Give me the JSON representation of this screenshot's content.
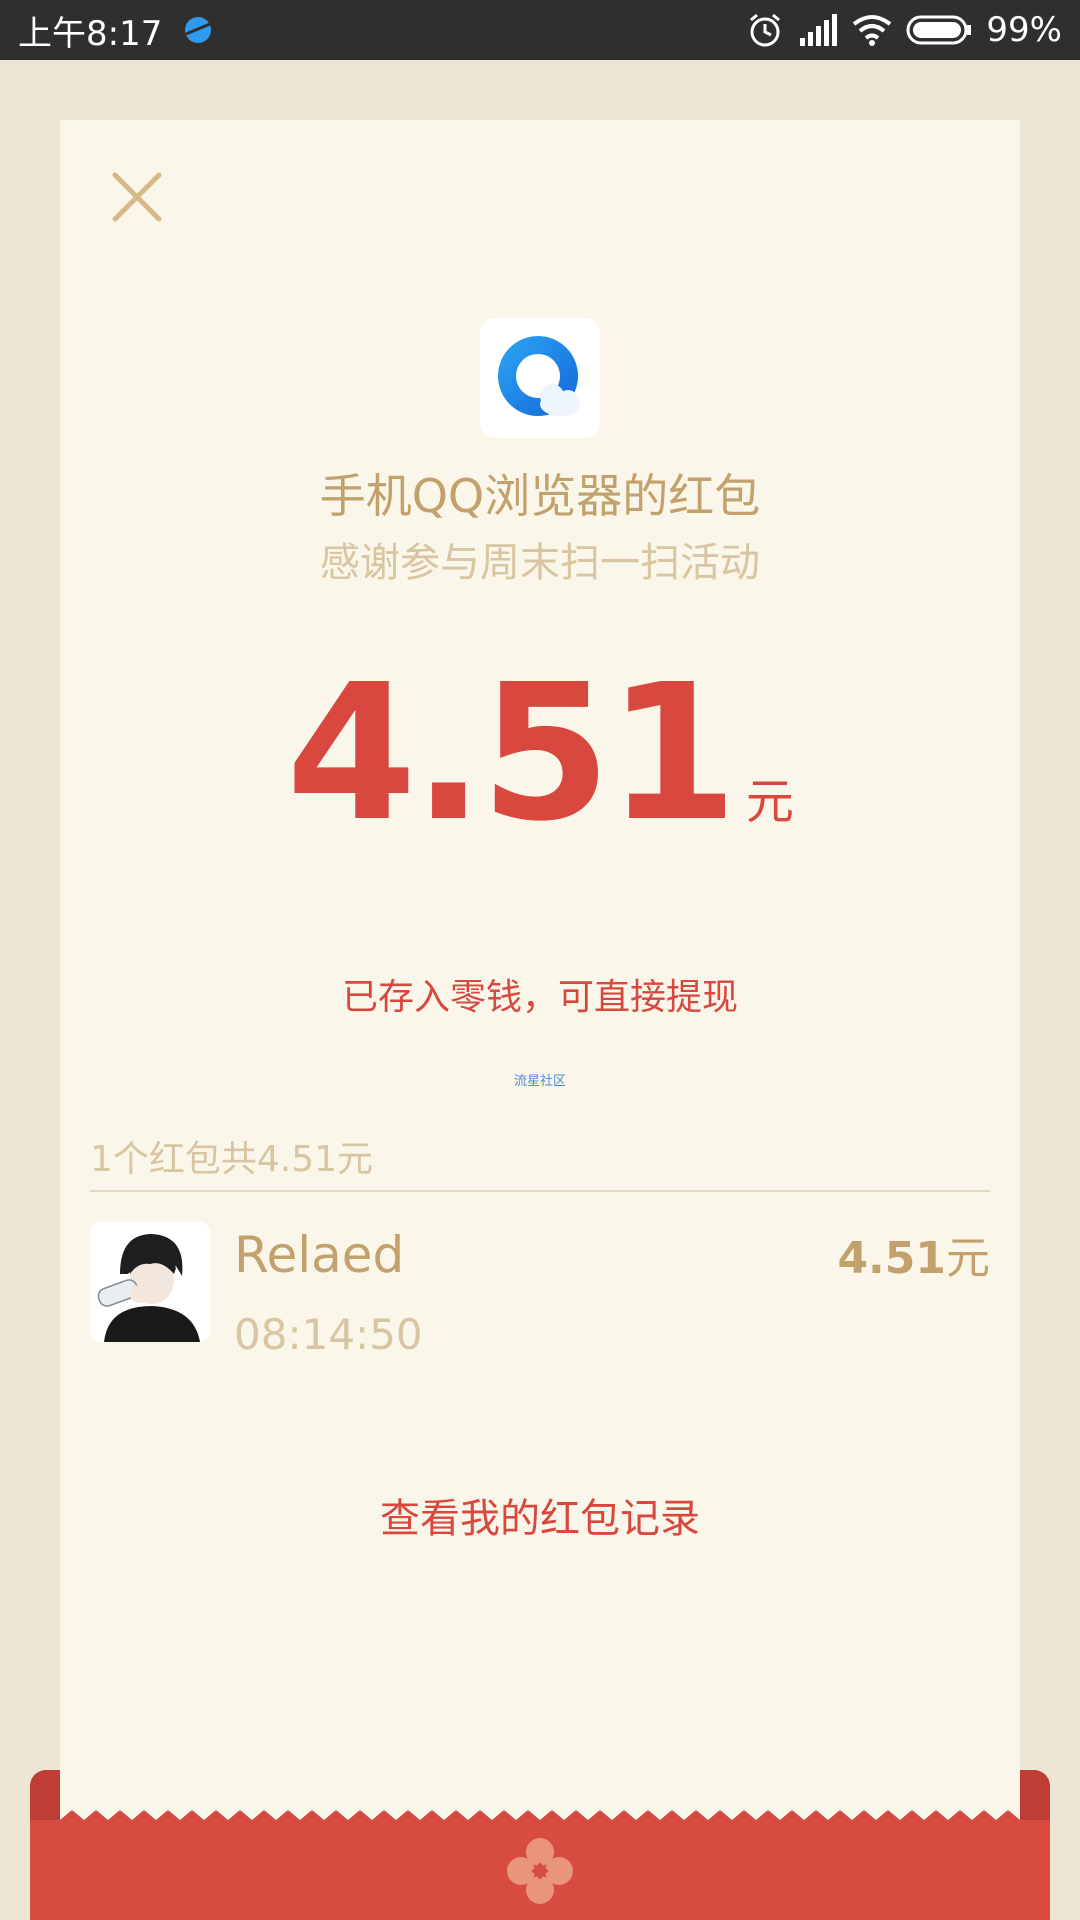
{
  "status_bar": {
    "time": "上午8:17",
    "battery_percent": "99%",
    "icons": [
      "app-icon",
      "alarm-icon",
      "signal-icon",
      "wifi-icon",
      "battery-icon"
    ]
  },
  "card": {
    "close_icon": "close-icon",
    "sender_title": "手机QQ浏览器的红包",
    "sender_subtitle": "感谢参与周末扫一扫活动",
    "amount": "4.51",
    "amount_unit": "元",
    "deposit_note": "已存入零钱，可直接提现",
    "community_link": "流星社区",
    "summary": "1个红包共4.51元",
    "records": [
      {
        "name": "Relaed",
        "time": "08:14:50",
        "amount": "4.51",
        "unit": "元"
      }
    ],
    "history_link": "查看我的红包记录"
  },
  "colors": {
    "accent_red": "#d9483f",
    "gold": "#c3a16c",
    "muted_gold": "#d8c5a1",
    "card_bg": "#faf6ea",
    "page_bg": "#ede6d4"
  }
}
